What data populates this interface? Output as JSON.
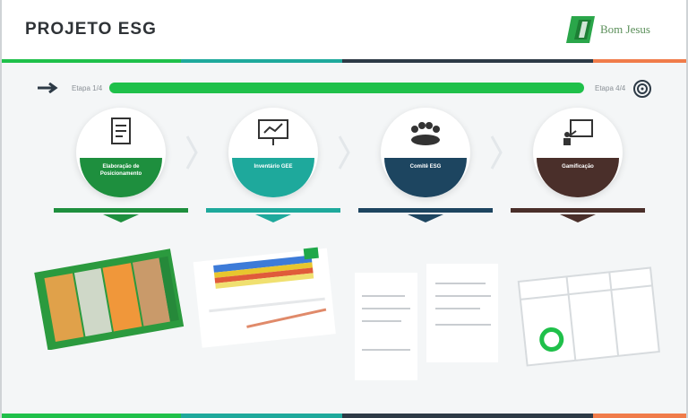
{
  "header": {
    "title": "PROJETO ESG",
    "logo_text": "Bom Jesus"
  },
  "progress": {
    "start_label": "Etapa 1/4",
    "end_label": "Etapa 4/4",
    "value": 1.0
  },
  "steps": [
    {
      "label": "Elaboração de Posicionamento",
      "color": "#1e8f3e"
    },
    {
      "label": "Inventário GEE",
      "color": "#1ea99c"
    },
    {
      "label": "Comitê ESG",
      "color": "#1d4560"
    },
    {
      "label": "Gamificação",
      "color": "#4a2f2a"
    }
  ],
  "colors": {
    "green": "#1fc04a",
    "teal": "#1ea99c",
    "navy": "#2d3a46",
    "orange": "#f07c4a"
  },
  "icons": [
    "arrow-icon",
    "target-icon",
    "document-icon",
    "presentation-icon",
    "meeting-icon",
    "whiteboard-icon"
  ]
}
